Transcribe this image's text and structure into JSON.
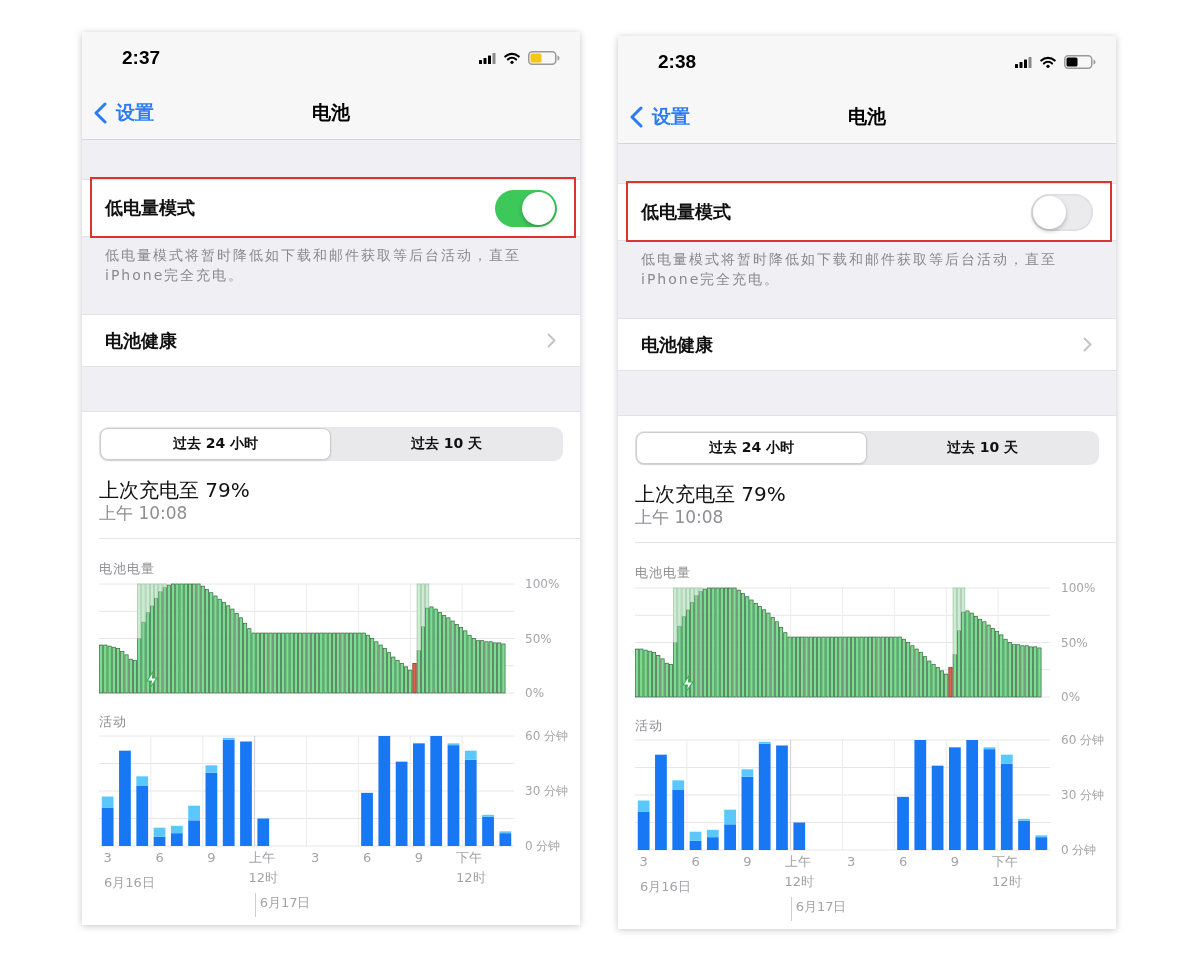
{
  "phones": [
    {
      "status_bar": {
        "time": "2:37"
      },
      "nav_bar": {
        "back": "设置",
        "title": "电池"
      },
      "low_power_mode": {
        "label": "低电量模式",
        "on": true,
        "highlighted": true,
        "footer": "低电量模式将暂时降低如下载和邮件获取等后台活动，直至iPhone完全充电。"
      },
      "battery_health": {
        "label": "电池健康"
      },
      "usage": {
        "tabs": [
          {
            "label": "过去 24 小时",
            "selected": true
          },
          {
            "label": "过去 10 天",
            "selected": false
          }
        ],
        "last_charge": {
          "title": "上次充电至 79%",
          "time": "上午 10:08"
        },
        "battery_level": {
          "chart_data": {
            "type": "bar",
            "title": "电池电量",
            "ylim": [
              0,
              100
            ],
            "yticks": [
              {
                "value": 100,
                "label": "100%"
              },
              {
                "value": 50,
                "label": "50%"
              },
              {
                "value": 0,
                "label": "0%"
              }
            ],
            "stacked": true,
            "series": [
              {
                "color": "#7ddc8f",
                "values": [
                  44,
                  44,
                  43,
                  42,
                  41,
                  38,
                  35,
                  31,
                  30,
                  50,
                  65,
                  74,
                  80,
                  87,
                  93,
                  97,
                  99,
                  100,
                  100,
                  100,
                  100,
                  100,
                  100,
                  100,
                  98,
                  95,
                  92,
                  89,
                  86,
                  83,
                  80,
                  77,
                  73,
                  69,
                  64,
                  59,
                  55,
                  55,
                  55,
                  55,
                  55,
                  55,
                  55,
                  55,
                  55,
                  55,
                  55,
                  55,
                  55,
                  55,
                  55,
                  55,
                  55,
                  55,
                  55,
                  55,
                  55,
                  55,
                  55,
                  55,
                  55,
                  55,
                  55,
                  53,
                  50,
                  47,
                  44,
                  41,
                  37,
                  33,
                  30,
                  27,
                  24,
                  21,
                  null,
                  39,
                  61,
                  78,
                  79,
                  77,
                  74,
                  71,
                  69,
                  66,
                  63,
                  60,
                  57,
                  53,
                  50,
                  48,
                  48,
                  47,
                  47,
                  46,
                  46,
                  45
                ]
              },
              {
                "color": "#e2634c",
                "values": [
                  null,
                  null,
                  null,
                  null,
                  null,
                  null,
                  null,
                  null,
                  null,
                  null,
                  null,
                  null,
                  null,
                  null,
                  null,
                  null,
                  null,
                  null,
                  null,
                  null,
                  null,
                  null,
                  null,
                  null,
                  null,
                  null,
                  null,
                  null,
                  null,
                  null,
                  null,
                  null,
                  null,
                  null,
                  null,
                  null,
                  null,
                  null,
                  null,
                  null,
                  null,
                  null,
                  null,
                  null,
                  null,
                  null,
                  null,
                  null,
                  null,
                  null,
                  null,
                  null,
                  null,
                  null,
                  null,
                  null,
                  null,
                  null,
                  null,
                  null,
                  null,
                  null,
                  null,
                  null,
                  null,
                  null,
                  null,
                  null,
                  null,
                  null,
                  null,
                  null,
                  null,
                  null,
                  27,
                  null,
                  null,
                  null,
                  null,
                  null,
                  null,
                  null,
                  null,
                  null,
                  null,
                  null,
                  null,
                  null,
                  null,
                  null,
                  null,
                  null,
                  null,
                  null,
                  null,
                  null
                ]
              },
              {
                "color": "#c9efd1",
                "values": [
                  null,
                  null,
                  null,
                  null,
                  null,
                  null,
                  null,
                  null,
                  null,
                  50,
                  35,
                  26,
                  20,
                  13,
                  7,
                  3,
                  null,
                  null,
                  null,
                  null,
                  null,
                  null,
                  null,
                  null,
                  null,
                  null,
                  null,
                  null,
                  null,
                  null,
                  null,
                  null,
                  null,
                  null,
                  null,
                  null,
                  null,
                  null,
                  null,
                  null,
                  null,
                  null,
                  null,
                  null,
                  null,
                  null,
                  null,
                  null,
                  null,
                  null,
                  null,
                  null,
                  null,
                  null,
                  null,
                  null,
                  null,
                  null,
                  null,
                  null,
                  null,
                  null,
                  null,
                  null,
                  null,
                  null,
                  null,
                  null,
                  null,
                  null,
                  null,
                  null,
                  null,
                  null,
                  null,
                  61,
                  39,
                  22,
                  null,
                  null,
                  null,
                  null,
                  null,
                  null,
                  null,
                  null,
                  null,
                  null,
                  null,
                  null,
                  null,
                  null,
                  null,
                  null,
                  null,
                  null,
                  null,
                  null
                ]
              }
            ]
          }
        },
        "activity": {
          "chart_data": {
            "type": "bar",
            "title": "活动",
            "ylim": [
              0,
              60
            ],
            "yticks": [
              {
                "value": 60,
                "label": "60 分钟"
              },
              {
                "value": 30,
                "label": "30 分钟"
              },
              {
                "value": 0,
                "label": "0 分钟"
              }
            ],
            "stacked": true,
            "categories": [
              "3",
              null,
              null,
              "6",
              null,
              null,
              "9",
              null,
              null,
              "上午 12时",
              null,
              null,
              "3",
              null,
              null,
              "6",
              null,
              null,
              "9",
              null,
              null,
              "下午 12时",
              null,
              null
            ],
            "series": [
              {
                "color": "#1877f2",
                "values": [
                  21,
                  52,
                  33,
                  5,
                  7,
                  14,
                  40,
                  58,
                  57,
                  15,
                  0,
                  0,
                  0,
                  0,
                  0,
                  29,
                  60,
                  46,
                  56,
                  60,
                  55,
                  47,
                  16,
                  7
                ]
              },
              {
                "color": "#5ac8fa",
                "values": [
                  6,
                  0,
                  5,
                  5,
                  4,
                  8,
                  4,
                  1,
                  0,
                  0,
                  0,
                  0,
                  0,
                  0,
                  0,
                  0,
                  0,
                  0,
                  0,
                  0,
                  1,
                  5,
                  1,
                  1
                ]
              }
            ],
            "annotations": [
              "6月16日",
              "6月17日"
            ]
          }
        }
      }
    },
    {
      "status_bar": {
        "time": "2:38"
      },
      "nav_bar": {
        "back": "设置",
        "title": "电池"
      },
      "low_power_mode": {
        "label": "低电量模式",
        "on": false,
        "highlighted": true,
        "footer": "低电量模式将暂时降低如下载和邮件获取等后台活动，直至iPhone完全充电。"
      },
      "battery_health": {
        "label": "电池健康"
      },
      "usage": {
        "tabs": [
          {
            "label": "过去 24 小时",
            "selected": true
          },
          {
            "label": "过去 10 天",
            "selected": false
          }
        ],
        "last_charge": {
          "title": "上次充电至 79%",
          "time": "上午 10:08"
        },
        "battery_level": {
          "chart_data": {
            "type": "bar",
            "title": "电池电量",
            "ylim": [
              0,
              100
            ],
            "yticks": [
              {
                "value": 100,
                "label": "100%"
              },
              {
                "value": 50,
                "label": "50%"
              },
              {
                "value": 0,
                "label": "0%"
              }
            ],
            "stacked": true,
            "series": [
              {
                "color": "#7ddc8f",
                "values": [
                  44,
                  44,
                  43,
                  42,
                  41,
                  38,
                  35,
                  31,
                  30,
                  50,
                  65,
                  74,
                  80,
                  87,
                  93,
                  97,
                  99,
                  100,
                  100,
                  100,
                  100,
                  100,
                  100,
                  100,
                  98,
                  95,
                  92,
                  89,
                  86,
                  83,
                  80,
                  77,
                  73,
                  69,
                  64,
                  59,
                  55,
                  55,
                  55,
                  55,
                  55,
                  55,
                  55,
                  55,
                  55,
                  55,
                  55,
                  55,
                  55,
                  55,
                  55,
                  55,
                  55,
                  55,
                  55,
                  55,
                  55,
                  55,
                  55,
                  55,
                  55,
                  55,
                  55,
                  53,
                  50,
                  47,
                  44,
                  41,
                  37,
                  33,
                  30,
                  27,
                  24,
                  21,
                  null,
                  39,
                  61,
                  78,
                  79,
                  77,
                  74,
                  71,
                  69,
                  66,
                  63,
                  60,
                  57,
                  53,
                  50,
                  48,
                  48,
                  47,
                  47,
                  46,
                  46,
                  45
                ]
              },
              {
                "color": "#e2634c",
                "values": [
                  null,
                  null,
                  null,
                  null,
                  null,
                  null,
                  null,
                  null,
                  null,
                  null,
                  null,
                  null,
                  null,
                  null,
                  null,
                  null,
                  null,
                  null,
                  null,
                  null,
                  null,
                  null,
                  null,
                  null,
                  null,
                  null,
                  null,
                  null,
                  null,
                  null,
                  null,
                  null,
                  null,
                  null,
                  null,
                  null,
                  null,
                  null,
                  null,
                  null,
                  null,
                  null,
                  null,
                  null,
                  null,
                  null,
                  null,
                  null,
                  null,
                  null,
                  null,
                  null,
                  null,
                  null,
                  null,
                  null,
                  null,
                  null,
                  null,
                  null,
                  null,
                  null,
                  null,
                  null,
                  null,
                  null,
                  null,
                  null,
                  null,
                  null,
                  null,
                  null,
                  null,
                  null,
                  27,
                  null,
                  null,
                  null,
                  null,
                  null,
                  null,
                  null,
                  null,
                  null,
                  null,
                  null,
                  null,
                  null,
                  null,
                  null,
                  null,
                  null,
                  null,
                  null,
                  null,
                  null
                ]
              },
              {
                "color": "#c9efd1",
                "values": [
                  null,
                  null,
                  null,
                  null,
                  null,
                  null,
                  null,
                  null,
                  null,
                  50,
                  35,
                  26,
                  20,
                  13,
                  7,
                  3,
                  null,
                  null,
                  null,
                  null,
                  null,
                  null,
                  null,
                  null,
                  null,
                  null,
                  null,
                  null,
                  null,
                  null,
                  null,
                  null,
                  null,
                  null,
                  null,
                  null,
                  null,
                  null,
                  null,
                  null,
                  null,
                  null,
                  null,
                  null,
                  null,
                  null,
                  null,
                  null,
                  null,
                  null,
                  null,
                  null,
                  null,
                  null,
                  null,
                  null,
                  null,
                  null,
                  null,
                  null,
                  null,
                  null,
                  null,
                  null,
                  null,
                  null,
                  null,
                  null,
                  null,
                  null,
                  null,
                  null,
                  null,
                  null,
                  null,
                  61,
                  39,
                  22,
                  null,
                  null,
                  null,
                  null,
                  null,
                  null,
                  null,
                  null,
                  null,
                  null,
                  null,
                  null,
                  null,
                  null,
                  null,
                  null,
                  null,
                  null,
                  null,
                  null
                ]
              }
            ]
          }
        },
        "activity": {
          "chart_data": {
            "type": "bar",
            "title": "活动",
            "ylim": [
              0,
              60
            ],
            "yticks": [
              {
                "value": 60,
                "label": "60 分钟"
              },
              {
                "value": 30,
                "label": "30 分钟"
              },
              {
                "value": 0,
                "label": "0 分钟"
              }
            ],
            "stacked": true,
            "categories": [
              "3",
              null,
              null,
              "6",
              null,
              null,
              "9",
              null,
              null,
              "上午 12时",
              null,
              null,
              "3",
              null,
              null,
              "6",
              null,
              null,
              "9",
              null,
              null,
              "下午 12时",
              null,
              null
            ],
            "series": [
              {
                "color": "#1877f2",
                "values": [
                  21,
                  52,
                  33,
                  5,
                  7,
                  14,
                  40,
                  58,
                  57,
                  15,
                  0,
                  0,
                  0,
                  0,
                  0,
                  29,
                  60,
                  46,
                  56,
                  60,
                  55,
                  47,
                  16,
                  7
                ]
              },
              {
                "color": "#5ac8fa",
                "values": [
                  6,
                  0,
                  5,
                  5,
                  4,
                  8,
                  4,
                  1,
                  0,
                  0,
                  0,
                  0,
                  0,
                  0,
                  0,
                  0,
                  0,
                  0,
                  0,
                  0,
                  1,
                  5,
                  1,
                  1
                ]
              }
            ],
            "annotations": [
              "6月16日",
              "6月17日"
            ]
          }
        }
      }
    }
  ]
}
